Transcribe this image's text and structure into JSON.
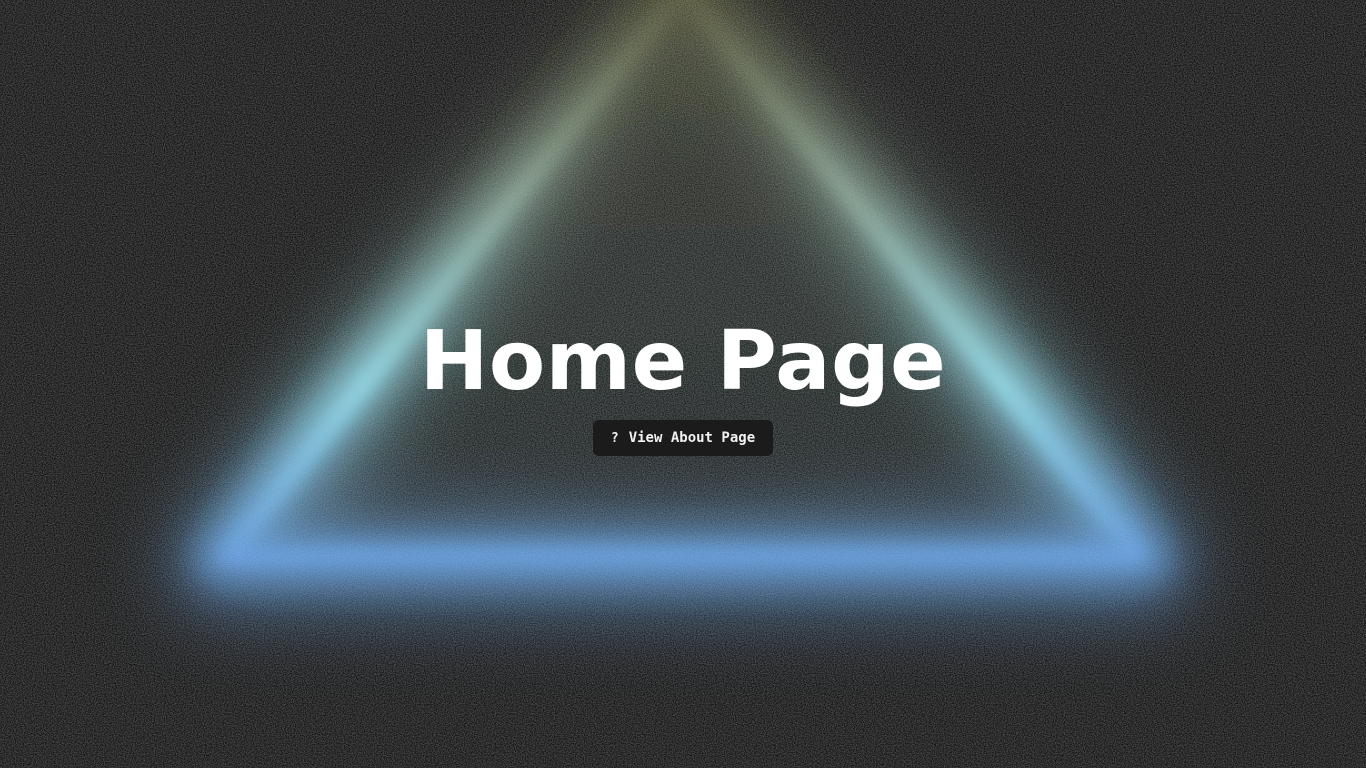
{
  "page": {
    "title": "Home Page"
  },
  "about_button": {
    "icon": "question-icon",
    "icon_glyph": "?",
    "label": "View About Page"
  },
  "colors": {
    "background": "#101010",
    "title_text": "#ffffff",
    "button_background": "#1b1b1b",
    "glow_cyan": "#7fdcf0",
    "glow_blue": "#4f8fe0",
    "glow_olive": "#6b6a3a"
  }
}
